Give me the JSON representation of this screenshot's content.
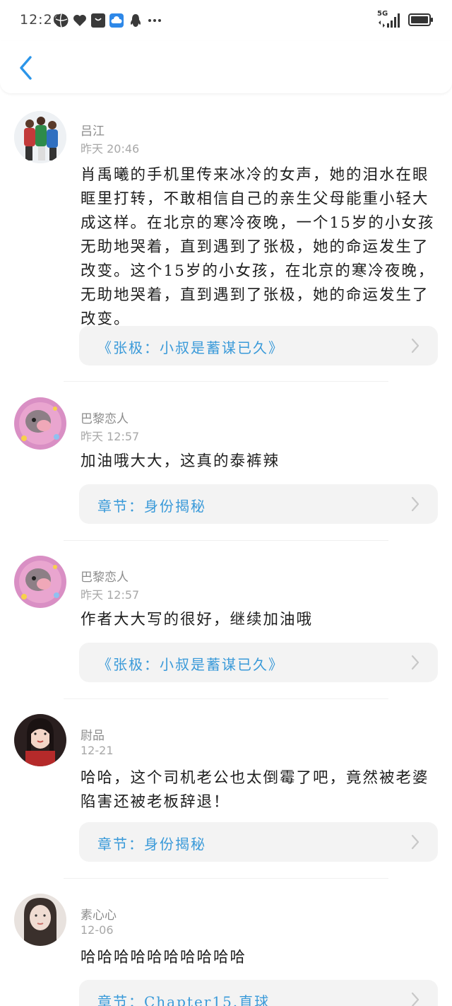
{
  "status_bar": {
    "time": "12:26",
    "network": "5G",
    "icons": [
      "basketball-icon",
      "heart-icon",
      "bag-icon",
      "cloud-icon",
      "qq-penguin-icon",
      "more-dots-icon"
    ]
  },
  "header": {
    "back_icon": "chevron-left-icon"
  },
  "comments": [
    {
      "name": "吕江",
      "time": "昨天 20:46",
      "text": "肖禹曦的手机里传来冰冷的女声，她的泪水在眼眶里打转，不敢相信自己的亲生父母能重小轻大成这样。在北京的寒冷夜晚，一个15岁的小女孩无助地哭着，直到遇到了张极，她的命运发生了改变。这个15岁的小女孩，在北京的寒冷夜晚，无助地哭着，直到遇到了张极，她的命运发生了改变。",
      "link": "《张极：小叔是蓄谋已久》"
    },
    {
      "name": "巴黎恋人",
      "time": "昨天 12:57",
      "text": "加油哦大大，这真的泰裤辣",
      "link": "章节：身份揭秘"
    },
    {
      "name": "巴黎恋人",
      "time": "昨天 12:57",
      "text": "作者大大写的很好，继续加油哦",
      "link": "《张极：小叔是蓄谋已久》"
    },
    {
      "name": "尉品",
      "time": "12-21",
      "text": "哈哈，这个司机老公也太倒霉了吧，竟然被老婆陷害还被老板辞退！",
      "link": "章节：身份揭秘"
    },
    {
      "name": "素心心",
      "time": "12-06",
      "text": "哈哈哈哈哈哈哈哈哈哈",
      "link": "章节：Chapter15.直球"
    }
  ],
  "colors": {
    "link_text": "#3a9ad9",
    "back_arrow": "#2b95e9",
    "link_bg": "#f3f3f3"
  }
}
